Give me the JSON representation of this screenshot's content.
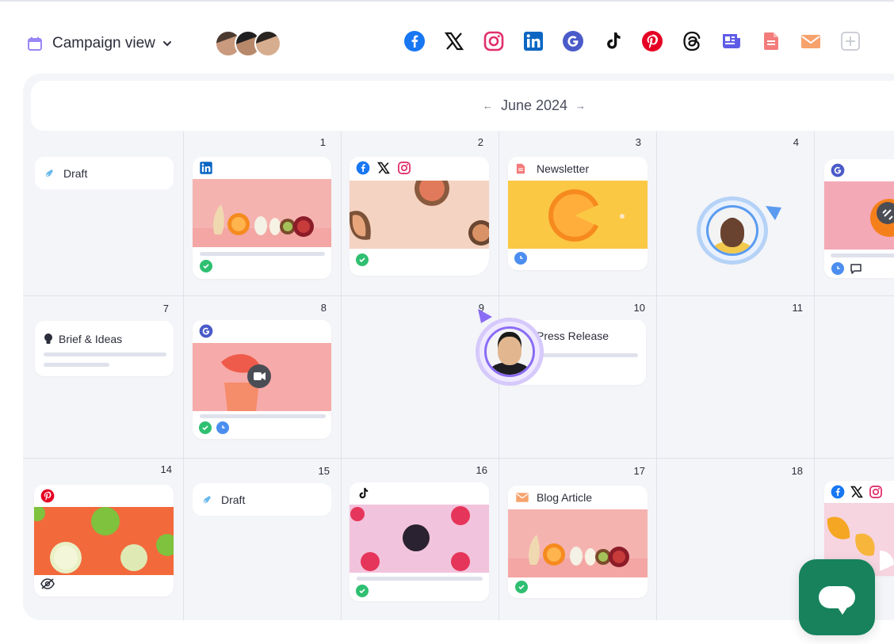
{
  "header": {
    "view_label": "Campaign view",
    "channels": [
      "facebook-icon",
      "x-icon",
      "instagram-icon",
      "linkedin-icon",
      "google-icon",
      "tiktok-icon",
      "pinterest-icon",
      "threads-icon",
      "newsletter-icon",
      "document-icon",
      "email-icon",
      "add-channel-icon"
    ]
  },
  "calendar": {
    "month_label": "June 2024",
    "weeks": [
      {
        "days": [
          "",
          "1",
          "2",
          "3",
          "4",
          ""
        ]
      },
      {
        "days": [
          "7",
          "8",
          "9",
          "10",
          "11",
          ""
        ]
      },
      {
        "days": [
          "14",
          "15",
          "16",
          "17",
          "18",
          ""
        ]
      }
    ],
    "cards": {
      "draft_1": "Draft",
      "newsletter": "Newsletter",
      "brief": "Brief & Ideas",
      "press": "Press Release",
      "draft_2": "Draft",
      "blog": "Blog Article"
    }
  },
  "colors": {
    "accent": "#6c5ce7",
    "success": "#2fbf71",
    "scheduled": "#4b8ef0",
    "chat": "#17825c"
  }
}
